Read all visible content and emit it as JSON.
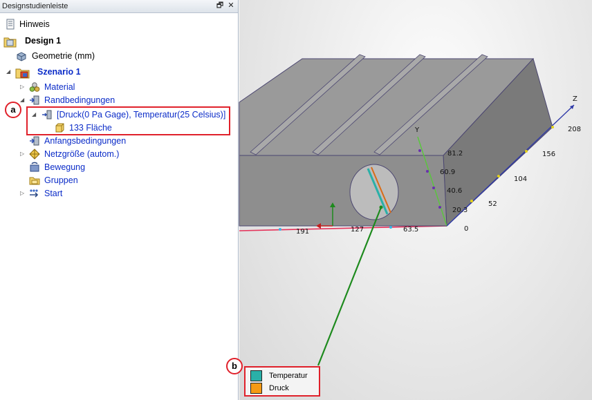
{
  "panel": {
    "title": "Designstudienleiste",
    "restore_glyph": "🗗",
    "close_glyph": "✕"
  },
  "tree": {
    "hint": "Hinweis",
    "design": "Design 1",
    "geometry": "Geometrie (mm)",
    "scenario": "Szenario 1",
    "material": "Material",
    "boundary": "Randbedingungen",
    "pressure_item": "[Druck(0 Pa Gage), Temperatur(25 Celsius)]",
    "surface": "133 Fläche",
    "initial": "Anfangsbedingungen",
    "mesh": "Netzgröße (autom.)",
    "motion": "Bewegung",
    "groups": "Gruppen",
    "start": "Start"
  },
  "callouts": {
    "a": "a",
    "b": "b"
  },
  "axes": {
    "y_label": "Y",
    "z_label": "Z",
    "y_ticks": [
      "81.2",
      "60.9",
      "40.6",
      "20.3",
      "0"
    ],
    "z_ticks": [
      "52",
      "104",
      "156",
      "208"
    ],
    "x_ticks": [
      "63.5",
      "127",
      "191"
    ]
  },
  "legend": {
    "items": [
      {
        "label": "Temperatur",
        "color": "#2ab0a8"
      },
      {
        "label": "Druck",
        "color": "#f59a14"
      }
    ]
  },
  "colors": {
    "callout_red": "#e0202a",
    "selection_blue": "#0b2cc8",
    "leader_green": "#1d8a1d"
  }
}
